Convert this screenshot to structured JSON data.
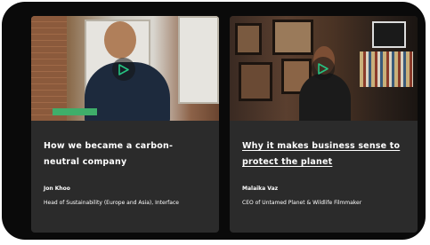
{
  "cards": [
    {
      "title": "How we became a carbon-neutral company",
      "author": "Jon Khoo",
      "role": "Head of Sustainability (Europe and Asia), Interface",
      "media_icon": "play-icon"
    },
    {
      "title": "Why it makes business sense to protect the planet",
      "author": "Malaika Vaz",
      "role": "CEO of Untamed Planet & Wildlife Filmmaker",
      "media_icon": "play-icon"
    }
  ],
  "colors": {
    "frame": "#0a0a0a",
    "card": "#2b2b2b",
    "play_accent": "#26c281",
    "text": "#ffffff"
  }
}
